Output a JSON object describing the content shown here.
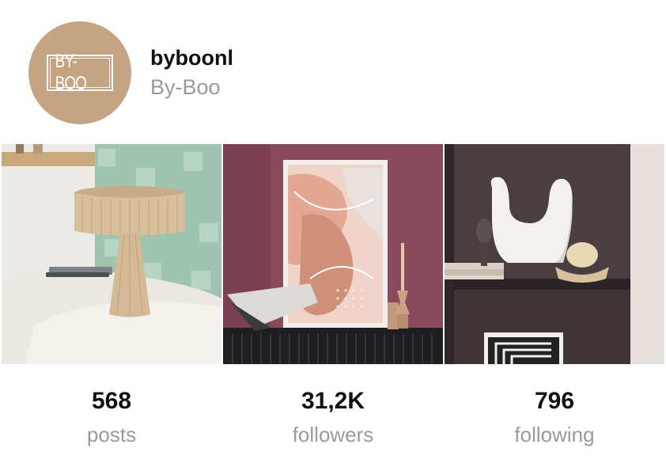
{
  "profile": {
    "username": "byboonl",
    "display_name": "By-Boo",
    "avatar_logo_text": "BY-BOO",
    "avatar_color": "#c4a482"
  },
  "posts": [
    {
      "subject": "rattan-table-lamp"
    },
    {
      "subject": "framed-abstract-print"
    },
    {
      "subject": "white-sculptural-vase"
    }
  ],
  "stats": {
    "posts": {
      "value": "568",
      "label": "posts"
    },
    "followers": {
      "value": "31,2K",
      "label": "followers"
    },
    "following": {
      "value": "796",
      "label": "following"
    }
  }
}
